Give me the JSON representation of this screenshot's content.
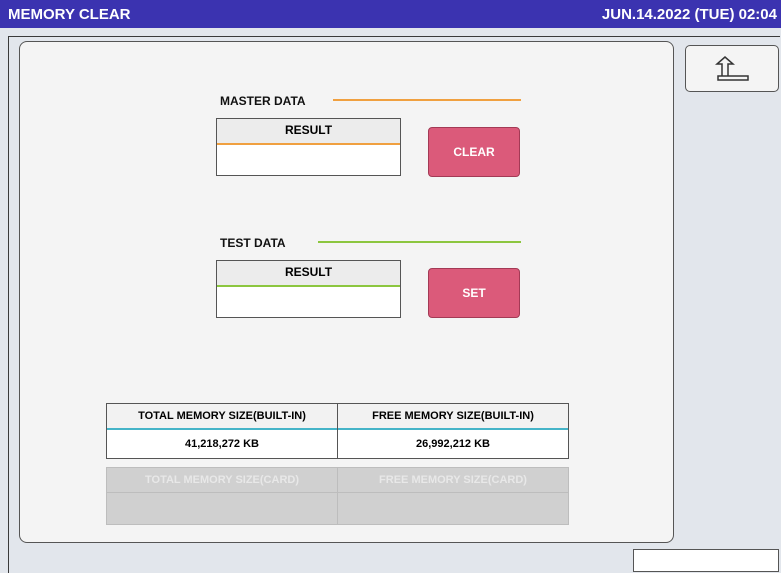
{
  "header": {
    "title": "MEMORY CLEAR",
    "datetime": "JUN.14.2022 (TUE)  02:04"
  },
  "master": {
    "label": "MASTER DATA",
    "result_label": "RESULT",
    "result_value": "",
    "button_label": "CLEAR",
    "accent": "#f0a040"
  },
  "test": {
    "label": "TEST DATA",
    "result_label": "RESULT",
    "result_value": "",
    "button_label": "SET",
    "accent": "#8cc63f"
  },
  "memory": {
    "total_builtin_label": "TOTAL MEMORY SIZE(BUILT-IN)",
    "total_builtin_value": "41,218,272 KB",
    "free_builtin_label": "FREE MEMORY SIZE(BUILT-IN)",
    "free_builtin_value": "26,992,212 KB",
    "total_card_label": "TOTAL MEMORY SIZE(CARD)",
    "total_card_value": "",
    "free_card_label": "FREE MEMORY SIZE(CARD)",
    "free_card_value": ""
  },
  "icons": {
    "back": "return-arrow-icon"
  },
  "colors": {
    "title_bar": "#3b33b0",
    "button": "#db5a7a",
    "memory_accent": "#45b4c8"
  }
}
